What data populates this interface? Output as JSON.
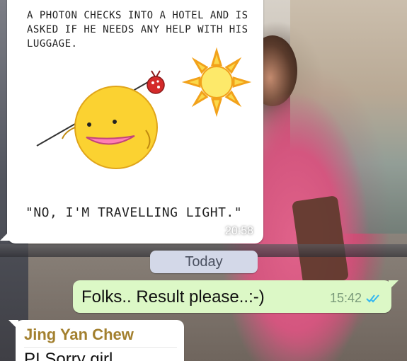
{
  "image_message": {
    "comic_caption": "A PHOTON CHECKS INTO A HOTEL AND IS ASKED IF HE NEEDS ANY HELP WITH HIS LUGGAGE.",
    "comic_punchline": "\"NO, I'M TRAVELLING LIGHT.\"",
    "time": "20:58"
  },
  "date_separator": "Today",
  "outgoing_message": {
    "text": "Folks.. Result please..:-)",
    "time": "15:42",
    "status_icon": "double-check-icon",
    "status_color": "#34b7f1"
  },
  "incoming_message": {
    "sender": "Jing Yan Chew",
    "text": "PI Sorry girl",
    "sender_color": "#a3802f"
  },
  "colors": {
    "outgoing_bubble": "#dcf8c6",
    "incoming_bubble": "#ffffff",
    "date_chip": "#d3d8e8"
  }
}
